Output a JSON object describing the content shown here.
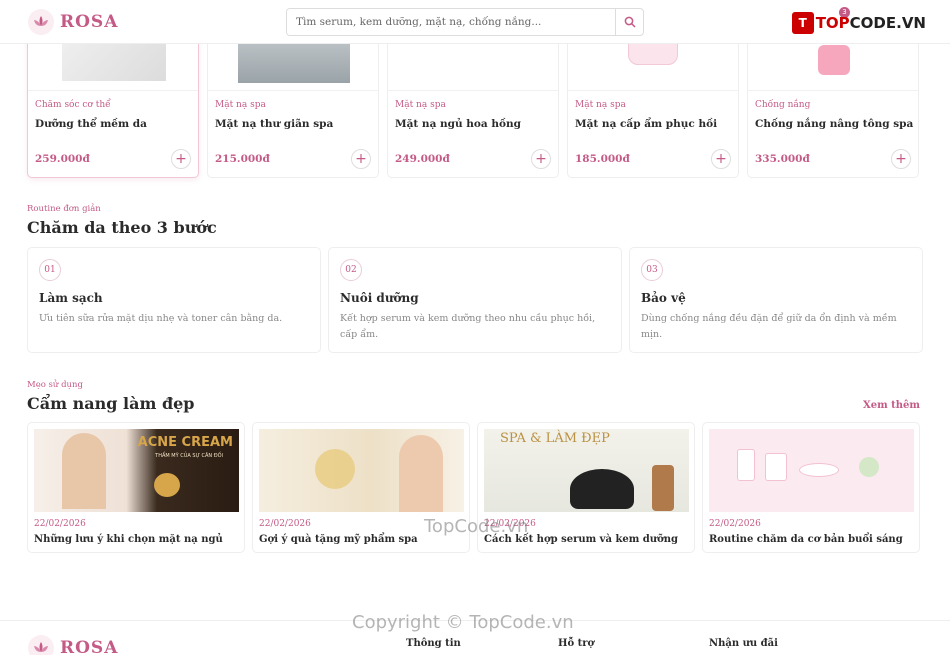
{
  "header": {
    "logo_text": "ROSA",
    "search_placeholder": "Tìm serum, kem dưỡng, mặt nạ, chống nắng...",
    "cart_count": "3",
    "brand_watermark": {
      "prefix": "TOP",
      "suffix": "CODE.VN",
      "box": "T"
    }
  },
  "products": [
    {
      "category": "Chăm sóc cơ thể",
      "name": "Dưỡng thể mềm da",
      "price": "259.000đ"
    },
    {
      "category": "Mặt nạ spa",
      "name": "Mặt nạ thư giãn spa",
      "price": "215.000đ"
    },
    {
      "category": "Mặt nạ spa",
      "name": "Mặt nạ ngủ hoa hồng",
      "price": "249.000đ"
    },
    {
      "category": "Mặt nạ spa",
      "name": "Mặt nạ cấp ẩm phục hồi",
      "price": "185.000đ"
    },
    {
      "category": "Chống nắng",
      "name": "Chống nắng nâng tông spa",
      "price": "335.000đ"
    }
  ],
  "routine": {
    "eyebrow": "Routine đơn giản",
    "title": "Chăm da theo 3 bước",
    "steps": [
      {
        "num": "01",
        "title": "Làm sạch",
        "desc": "Ưu tiên sữa rửa mặt dịu nhẹ và toner cân bằng da."
      },
      {
        "num": "02",
        "title": "Nuôi dưỡng",
        "desc": "Kết hợp serum và kem dưỡng theo nhu cầu phục hồi, cấp ẩm."
      },
      {
        "num": "03",
        "title": "Bảo vệ",
        "desc": "Dùng chống nắng đều đặn để giữ da ổn định và mềm mịn."
      }
    ]
  },
  "blog": {
    "eyebrow": "Mẹo sử dụng",
    "title": "Cẩm nang làm đẹp",
    "see_more": "Xem thêm",
    "posts": [
      {
        "date": "22/02/2026",
        "title": "Những lưu ý khi chọn mặt nạ ngủ",
        "banner": "ACNE CREAM",
        "banner_sub": "THẨM MỸ CỦA SỰ CÂN ĐỐI"
      },
      {
        "date": "22/02/2026",
        "title": "Gợi ý quà tặng mỹ phẩm spa",
        "banner": "",
        "banner_sub": ""
      },
      {
        "date": "22/02/2026",
        "title": "Cách kết hợp serum và kem dưỡng",
        "banner": "SPA & LÀM ĐẸP",
        "banner_sub": ""
      },
      {
        "date": "22/02/2026",
        "title": "Routine chăm da cơ bản buổi sáng",
        "banner": "",
        "banner_sub": ""
      }
    ]
  },
  "footer": {
    "logo_text": "ROSA",
    "columns": [
      "Thông tin",
      "Hỗ trợ",
      "Nhận ưu đãi"
    ]
  },
  "watermarks": {
    "center": "TopCode.vn",
    "copyright": "Copyright © TopCode.vn"
  },
  "colors": {
    "accent": "#c45a86",
    "border": "#eeeeee",
    "text": "#2b2b2b",
    "muted": "#888888"
  }
}
